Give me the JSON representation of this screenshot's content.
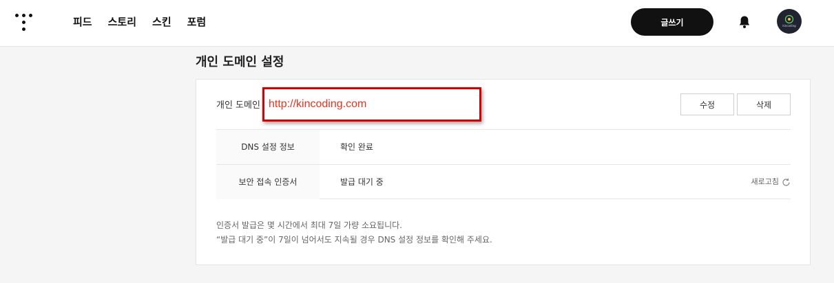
{
  "header": {
    "nav": [
      "피드",
      "스토리",
      "스킨",
      "포럼"
    ],
    "write_label": "글쓰기",
    "avatar_text": "kincoding"
  },
  "page": {
    "title": "개인 도메인 설정"
  },
  "domain": {
    "label": "개인 도메인",
    "value": "http://kincoding.com",
    "edit_label": "수정",
    "delete_label": "삭제"
  },
  "rows": [
    {
      "key": "DNS 설정 정보",
      "value": "확인 완료"
    },
    {
      "key": "보안 접속 인증서",
      "value": "발급 대기 중"
    }
  ],
  "refresh_label": "새로고침",
  "notes": [
    "인증서 발급은 몇 시간에서 최대 7일 가량 소요됩니다.",
    "“발급 대기 중”이 7일이 넘어서도 지속될 경우 DNS 설정 정보를 확인해 주세요."
  ],
  "colors": {
    "accent_red": "#d60000",
    "domain_text": "#e8321e",
    "button_dark": "#111111"
  }
}
